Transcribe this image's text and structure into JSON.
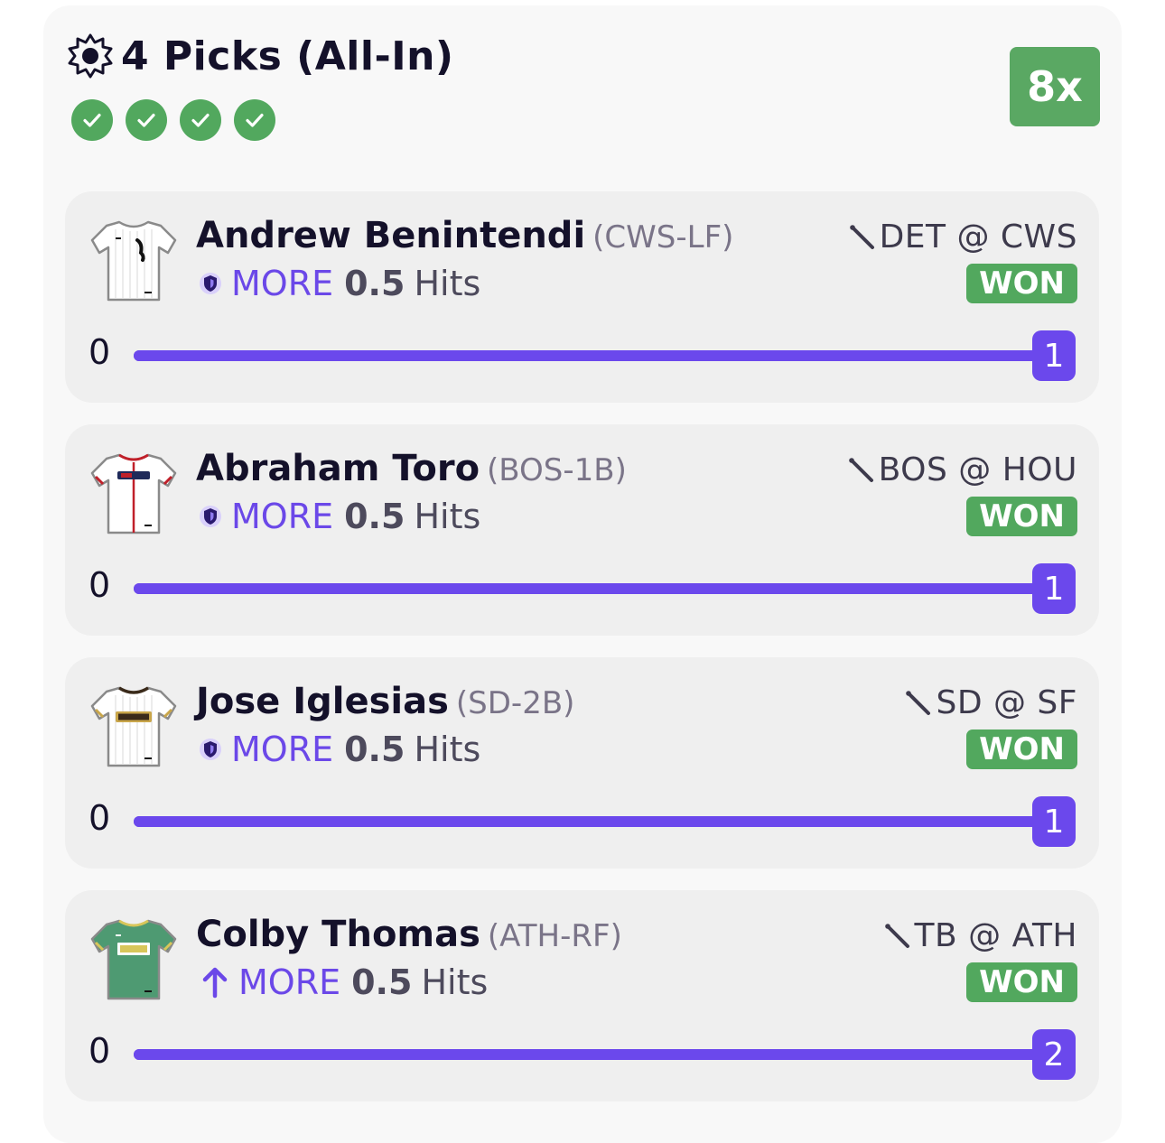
{
  "header": {
    "title": "4 Picks (All-In)",
    "icon": "sun-icon",
    "check_icons": [
      "check-icon",
      "check-icon",
      "check-icon",
      "check-icon"
    ],
    "multiplier": "8x"
  },
  "colors": {
    "accent": "#6b48ec",
    "won_green": "#52a85e",
    "card_bg": "#efefef"
  },
  "picks": [
    {
      "name": "Andrew Benintendi",
      "position": "(CWS-LF)",
      "jersey_icon": "jersey-icon",
      "prop_icon": "shield-icon",
      "direction": "MORE",
      "line": "0.5",
      "stat": "Hits",
      "matchup": "DET @ CWS",
      "result": "WON",
      "progress_start": "0",
      "progress_value": "1",
      "progress_fraction": 1.0
    },
    {
      "name": "Abraham Toro",
      "position": "(BOS-1B)",
      "jersey_icon": "jersey-icon",
      "prop_icon": "shield-icon",
      "direction": "MORE",
      "line": "0.5",
      "stat": "Hits",
      "matchup": "BOS @ HOU",
      "result": "WON",
      "progress_start": "0",
      "progress_value": "1",
      "progress_fraction": 1.0
    },
    {
      "name": "Jose Iglesias",
      "position": "(SD-2B)",
      "jersey_icon": "jersey-icon",
      "prop_icon": "shield-icon",
      "direction": "MORE",
      "line": "0.5",
      "stat": "Hits",
      "matchup": "SD @ SF",
      "result": "WON",
      "progress_start": "0",
      "progress_value": "1",
      "progress_fraction": 1.0
    },
    {
      "name": "Colby Thomas",
      "position": "(ATH-RF)",
      "jersey_icon": "jersey-icon",
      "prop_icon": "arrow-up-icon",
      "direction": "MORE",
      "line": "0.5",
      "stat": "Hits",
      "matchup": "TB @ ATH",
      "result": "WON",
      "progress_start": "0",
      "progress_value": "2",
      "progress_fraction": 1.0
    }
  ]
}
